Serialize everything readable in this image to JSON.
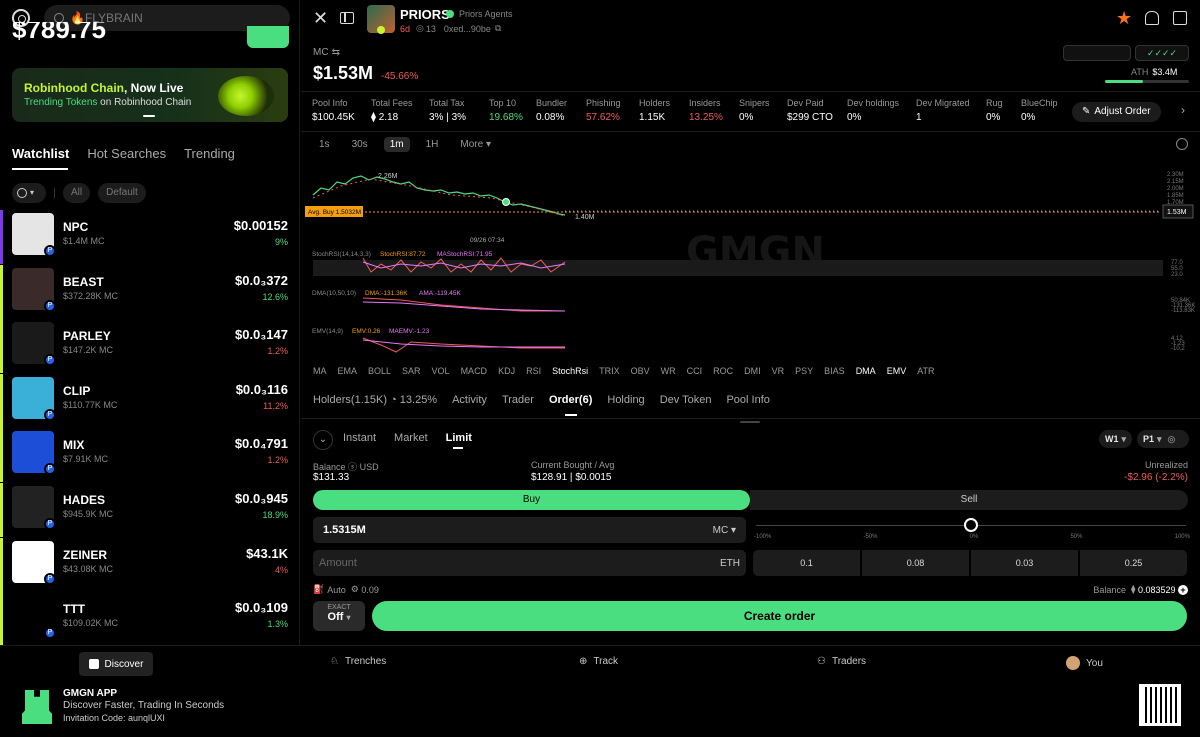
{
  "left": {
    "search_placeholder": "🔥FLYBRAIN",
    "balance": "$789.75",
    "banner": {
      "title_a": "Robinhood Chain",
      "title_b": ", Now Live",
      "sub_a": "Trending Tokens",
      "sub_b": " on Robinhood Chain"
    },
    "tabs": [
      "Watchlist",
      "Hot Searches",
      "Trending"
    ],
    "chips": [
      "All",
      "Default"
    ],
    "watchlist": [
      {
        "name": "NPC",
        "mc": "$1.4M MC",
        "price": "$0.00152",
        "change": "9%",
        "dir": "up",
        "bar": "#7c3aed",
        "bg": "#e5e5e5"
      },
      {
        "name": "BEAST",
        "mc": "$372.28K MC",
        "price": "$0.0₃372",
        "change": "12.6%",
        "dir": "up",
        "bar": "#c6f432",
        "bg": "#3a2a2a"
      },
      {
        "name": "PARLEY",
        "mc": "$147.2K MC",
        "price": "$0.0₃147",
        "change": "1.2%",
        "dir": "dn",
        "bar": "#c6f432",
        "bg": "#1a1a1a"
      },
      {
        "name": "CLIP",
        "mc": "$110.77K MC",
        "price": "$0.0₃116",
        "change": "11.2%",
        "dir": "dn",
        "bar": "#c6f432",
        "bg": "#3ab0d8"
      },
      {
        "name": "MIX",
        "mc": "$7.91K MC",
        "price": "$0.0₄791",
        "change": "1.2%",
        "dir": "dn",
        "bar": "#c6f432",
        "bg": "#1d4ed8"
      },
      {
        "name": "HADES",
        "mc": "$945.9K MC",
        "price": "$0.0₃945",
        "change": "18.9%",
        "dir": "up",
        "bar": "#c6f432",
        "bg": "#222"
      },
      {
        "name": "ZEINER",
        "mc": "$43.08K MC",
        "price": "$43.1K",
        "change": "4%",
        "dir": "dn",
        "bar": "#c6f432",
        "bg": "#fff"
      },
      {
        "name": "TTT",
        "mc": "$109.02K MC",
        "price": "$0.0₃109",
        "change": "1.3%",
        "dir": "up",
        "bar": "#c6f432",
        "bg": "#000"
      }
    ]
  },
  "token": {
    "name": "PRIORS",
    "full_name": "Priors Agents",
    "age": "6d",
    "holders_short": "13",
    "address": "0xed...90be",
    "mc_label": "MC",
    "price": "$1.53M",
    "change": "-45.66%",
    "ath_label": "ATH",
    "ath": "$3.4M"
  },
  "stats": [
    {
      "k": "Pool Info",
      "v": "$100.45K",
      "c": "#fff"
    },
    {
      "k": "Total Fees",
      "v": "⧫ 2.18",
      "c": "#fff"
    },
    {
      "k": "Total Tax",
      "v": "3% | 3%",
      "c": "#fff"
    },
    {
      "k": "Top 10",
      "v": "19.68%",
      "c": "#4ade80"
    },
    {
      "k": "Bundler",
      "v": "0.08%",
      "c": "#fff"
    },
    {
      "k": "Phishing",
      "v": "57.62%",
      "c": "#f05a5a"
    },
    {
      "k": "Holders",
      "v": "1.15K",
      "c": "#fff"
    },
    {
      "k": "Insiders",
      "v": "13.25%",
      "c": "#f05a5a"
    },
    {
      "k": "Snipers",
      "v": "0%",
      "c": "#fff"
    },
    {
      "k": "Dev Paid",
      "v": "$299 CTO",
      "c": "#fff"
    },
    {
      "k": "Dev holdings",
      "v": "0%",
      "c": "#fff"
    },
    {
      "k": "Dev Migrated",
      "v": "1",
      "c": "#fff"
    },
    {
      "k": "Rug",
      "v": "0%",
      "c": "#fff"
    },
    {
      "k": "BlueChip",
      "v": "0%",
      "c": "#fff"
    }
  ],
  "adjust_order": "Adjust Order",
  "intervals": [
    "1s",
    "30s",
    "1m",
    "1H",
    "More"
  ],
  "chart_labels": {
    "high": "2.26M",
    "low": "1.40M",
    "avg_buy": "Avg. Buy 1.5032M",
    "current": "1.53M",
    "axis": [
      "2.30M",
      "2.15M",
      "2.00M",
      "1.85M",
      "1.70M"
    ],
    "date": "09/26 07:34",
    "stoch": "StochRSI(14,14,3,3)",
    "stoch_k": "StochRSI:87.72",
    "stoch_d": "MAStochRSI:71.95",
    "stoch_axis": [
      "77.0",
      "55.0",
      "23.0"
    ],
    "dma": "DMA(10,50,10)",
    "dma_v": "DMA:-131.36K",
    "ama_v": "AMA:-119.45K",
    "dma_axis": [
      "50.84K",
      "-131.36K",
      "-113.83K"
    ],
    "emv": "EMV(14,9)",
    "emv_v": "EMV:0.26",
    "maemv_v": "MAEMV:-1.23",
    "emv_axis": [
      "4.12",
      "-1.23",
      "-10.2"
    ],
    "watermark": "GMGN"
  },
  "indicators": [
    "MA",
    "EMA",
    "BOLL",
    "SAR",
    "VOL",
    "MACD",
    "KDJ",
    "RSI",
    "StochRsi",
    "TRIX",
    "OBV",
    "WR",
    "CCI",
    "ROC",
    "DMI",
    "VR",
    "PSY",
    "BIAS",
    "DMA",
    "EMV",
    "ATR"
  ],
  "subtabs": {
    "holders": "Holders",
    "holders_count": "1.15K",
    "holders_pct": "13.25%",
    "activity": "Activity",
    "trader": "Trader",
    "order": "Order",
    "order_count": "6",
    "holding": "Holding",
    "dev_token": "Dev Token",
    "pool_info": "Pool Info"
  },
  "order": {
    "types": [
      "Instant",
      "Market",
      "Limit"
    ],
    "w1": "W1",
    "p1": "P1",
    "balance_label": "Balance",
    "balance_unit": "USD",
    "balance_val": "$131.33",
    "bought_label": "Current Bought / Avg",
    "bought_val": "$128.91",
    "bought_avg": "$0.0015",
    "unrealized_label": "Unrealized",
    "unrealized_val": "-$2.96",
    "unrealized_pct": "-2.2%",
    "buy": "Buy",
    "sell": "Sell",
    "target_value": "1.5315M",
    "target_unit": "MC",
    "slider": [
      "-100%",
      "-50%",
      "0%",
      "50%",
      "100%"
    ],
    "amount_placeholder": "Amount",
    "amount_unit": "ETH",
    "quick": [
      "0.1",
      "0.08",
      "0.03",
      "0.25"
    ],
    "auto": "Auto",
    "gas": "0.09",
    "bal_label": "Balance",
    "bal_val": "0.083529",
    "exact_label": "EXACT",
    "exact_val": "Off",
    "create": "Create order"
  },
  "nav": [
    "Discover",
    "Trenches",
    "Track",
    "Traders",
    "You"
  ],
  "app": {
    "title": "GMGN APP",
    "tag": "Discover Faster, Trading In Seconds",
    "invite": "Invitation Code: aunqlUXl"
  }
}
